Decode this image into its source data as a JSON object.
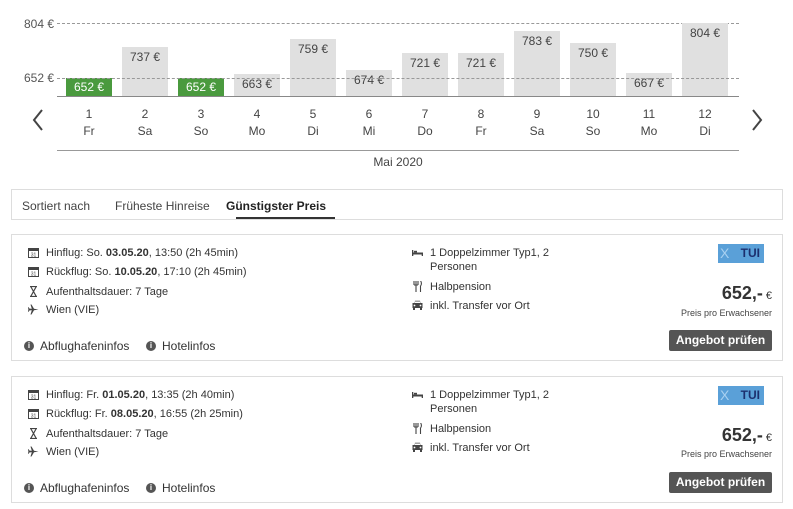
{
  "chart_data": {
    "type": "bar",
    "categories": [
      "1",
      "2",
      "3",
      "4",
      "5",
      "6",
      "7",
      "8",
      "9",
      "10",
      "11",
      "12"
    ],
    "weekdays": [
      "Fr",
      "Sa",
      "So",
      "Mo",
      "Di",
      "Mi",
      "Do",
      "Fr",
      "Sa",
      "So",
      "Mo",
      "Di"
    ],
    "values": [
      652,
      737,
      652,
      663,
      759,
      674,
      721,
      721,
      783,
      750,
      667,
      804
    ],
    "value_labels": [
      "652 €",
      "737 €",
      "652 €",
      "663 €",
      "759 €",
      "674 €",
      "721 €",
      "721 €",
      "783 €",
      "750 €",
      "667 €",
      "804 €"
    ],
    "highlighted": [
      true,
      false,
      true,
      false,
      false,
      false,
      false,
      false,
      false,
      false,
      false,
      false
    ],
    "y_ticks": [
      652,
      804
    ],
    "y_tick_labels": [
      "652 €",
      "804 €"
    ],
    "xlabel": "Mai 2020",
    "colors": {
      "bar": "#e0e0e0",
      "cheapest": "#4a9a3e"
    }
  },
  "sort": {
    "label": "Sortiert nach",
    "options": [
      "Früheste Hinreise",
      "Günstigster Preis"
    ],
    "active": "Günstigster Preis"
  },
  "offers": [
    {
      "outbound_prefix": "Hinflug: So. ",
      "outbound_date": "03.05.20",
      "outbound_suffix": ", 13:50 (2h 45min)",
      "return_prefix": "Rückflug: So. ",
      "return_date": "10.05.20",
      "return_suffix": ", 17:10 (2h 45min)",
      "stay": "Aufenthaltsdauer: 7 Tage",
      "airport": "Wien (VIE)",
      "room_line1": "1 Doppelzimmer Typ1, 2",
      "room_line2": "Personen",
      "board": "Halbpension",
      "transfer": "inkl. Transfer vor Ort",
      "operator_mark": "X",
      "operator": "TUI",
      "price": "652,-",
      "currency": "€",
      "price_note": "Preis pro Erwachsener",
      "cta": "Angebot prüfen",
      "info_airport": "Abflughafeninfos",
      "info_hotel": "Hotelinfos"
    },
    {
      "outbound_prefix": "Hinflug: Fr. ",
      "outbound_date": "01.05.20",
      "outbound_suffix": ", 13:35 (2h 40min)",
      "return_prefix": "Rückflug: Fr. ",
      "return_date": "08.05.20",
      "return_suffix": ", 16:55 (2h 25min)",
      "stay": "Aufenthaltsdauer: 7 Tage",
      "airport": "Wien (VIE)",
      "room_line1": "1 Doppelzimmer Typ1, 2",
      "room_line2": "Personen",
      "board": "Halbpension",
      "transfer": "inkl. Transfer vor Ort",
      "operator_mark": "X",
      "operator": "TUI",
      "price": "652,-",
      "currency": "€",
      "price_note": "Preis pro Erwachsener",
      "cta": "Angebot prüfen",
      "info_airport": "Abflughafeninfos",
      "info_hotel": "Hotelinfos"
    }
  ],
  "icons": {
    "prev": "chevron-left-icon",
    "next": "chevron-right-icon",
    "calendar": "calendar-icon",
    "hourglass": "hourglass-icon",
    "plane": "plane-icon",
    "bed": "bed-icon",
    "cutlery": "cutlery-icon",
    "car": "car-icon",
    "info": "info-icon"
  }
}
